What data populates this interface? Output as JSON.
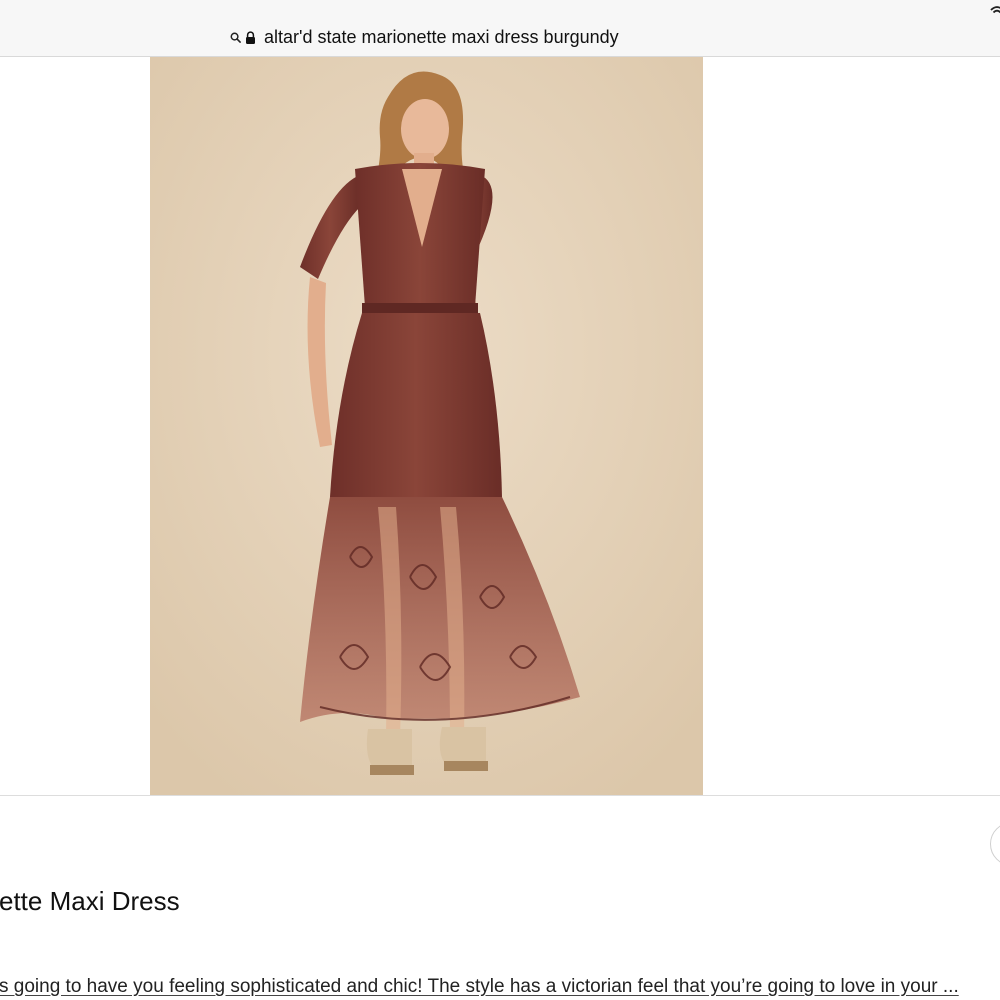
{
  "address_bar": {
    "url_text": "altar'd state marionette maxi dress burgundy",
    "icons": [
      "search-icon",
      "lock-icon",
      "wifi-icon"
    ]
  },
  "product": {
    "image_alt": "Model wearing burgundy lace maxi dress",
    "title": "ette Maxi Dress",
    "description": "s going to have you feeling sophisticated and chic! The style has a victorian feel that you’re going to love in your ..."
  },
  "colors": {
    "background": "#ffffff",
    "address_bar_bg": "#f7f7f7",
    "photo_background": "#e3d1b8",
    "dress": "#7a3a32"
  }
}
